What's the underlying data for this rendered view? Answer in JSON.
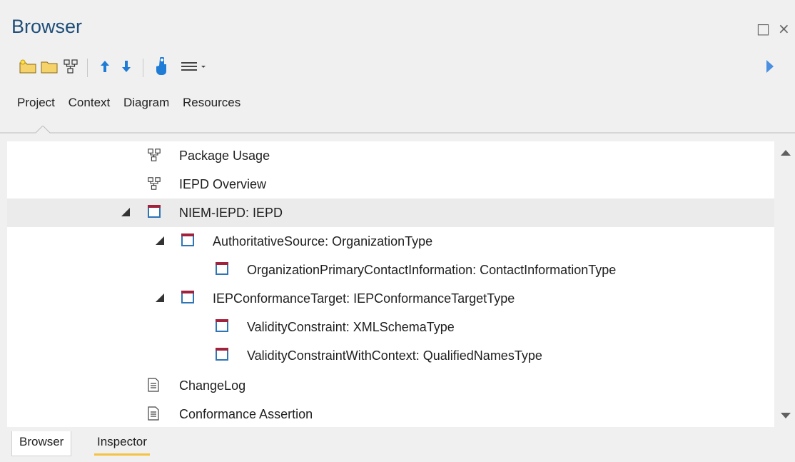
{
  "panel": {
    "title": "Browser"
  },
  "window_controls": {
    "maximize_glyph": "□",
    "close_glyph": "×"
  },
  "toolbar": {
    "icons": [
      "new-package-icon",
      "folder-icon",
      "diagram-icon",
      "move-up-icon",
      "move-down-icon",
      "hand-icon",
      "menu-icon",
      "expand-right-icon"
    ],
    "colors": {
      "up_down_arrow": "#1e7bd6",
      "play_arrow": "#4a8fe0"
    }
  },
  "tabs": [
    "Project",
    "Context",
    "Diagram",
    "Resources"
  ],
  "tree": {
    "rows": [
      {
        "label": "Package Usage",
        "icon": "diagram-icon",
        "expanded": false
      },
      {
        "label": "IEPD Overview",
        "icon": "diagram-icon",
        "expanded": false
      },
      {
        "label": "NIEM-IEPD: IEPD",
        "icon": "class-icon",
        "expanded": true,
        "selected": true
      },
      {
        "label": "AuthoritativeSource: OrganizationType",
        "icon": "class-icon",
        "expanded": true
      },
      {
        "label": "OrganizationPrimaryContactInformation: ContactInformationType",
        "icon": "class-icon",
        "expanded": false
      },
      {
        "label": "IEPConformanceTarget: IEPConformanceTargetType",
        "icon": "class-icon",
        "expanded": true
      },
      {
        "label": "ValidityConstraint: XMLSchemaType",
        "icon": "class-icon",
        "expanded": false
      },
      {
        "label": "ValidityConstraintWithContext: QualifiedNamesType",
        "icon": "class-icon",
        "expanded": false
      },
      {
        "label": "ChangeLog",
        "icon": "document-icon",
        "expanded": false
      },
      {
        "label": "Conformance Assertion",
        "icon": "document-icon",
        "expanded": false
      }
    ]
  },
  "bottom_tabs": [
    {
      "label": "Browser",
      "active": true
    },
    {
      "label": "Inspector",
      "active": false
    }
  ],
  "colors": {
    "title": "#1f4e79",
    "class_border": "#2e75b6",
    "class_top": "#a0223c",
    "inspector_underline": "#f5c242"
  }
}
